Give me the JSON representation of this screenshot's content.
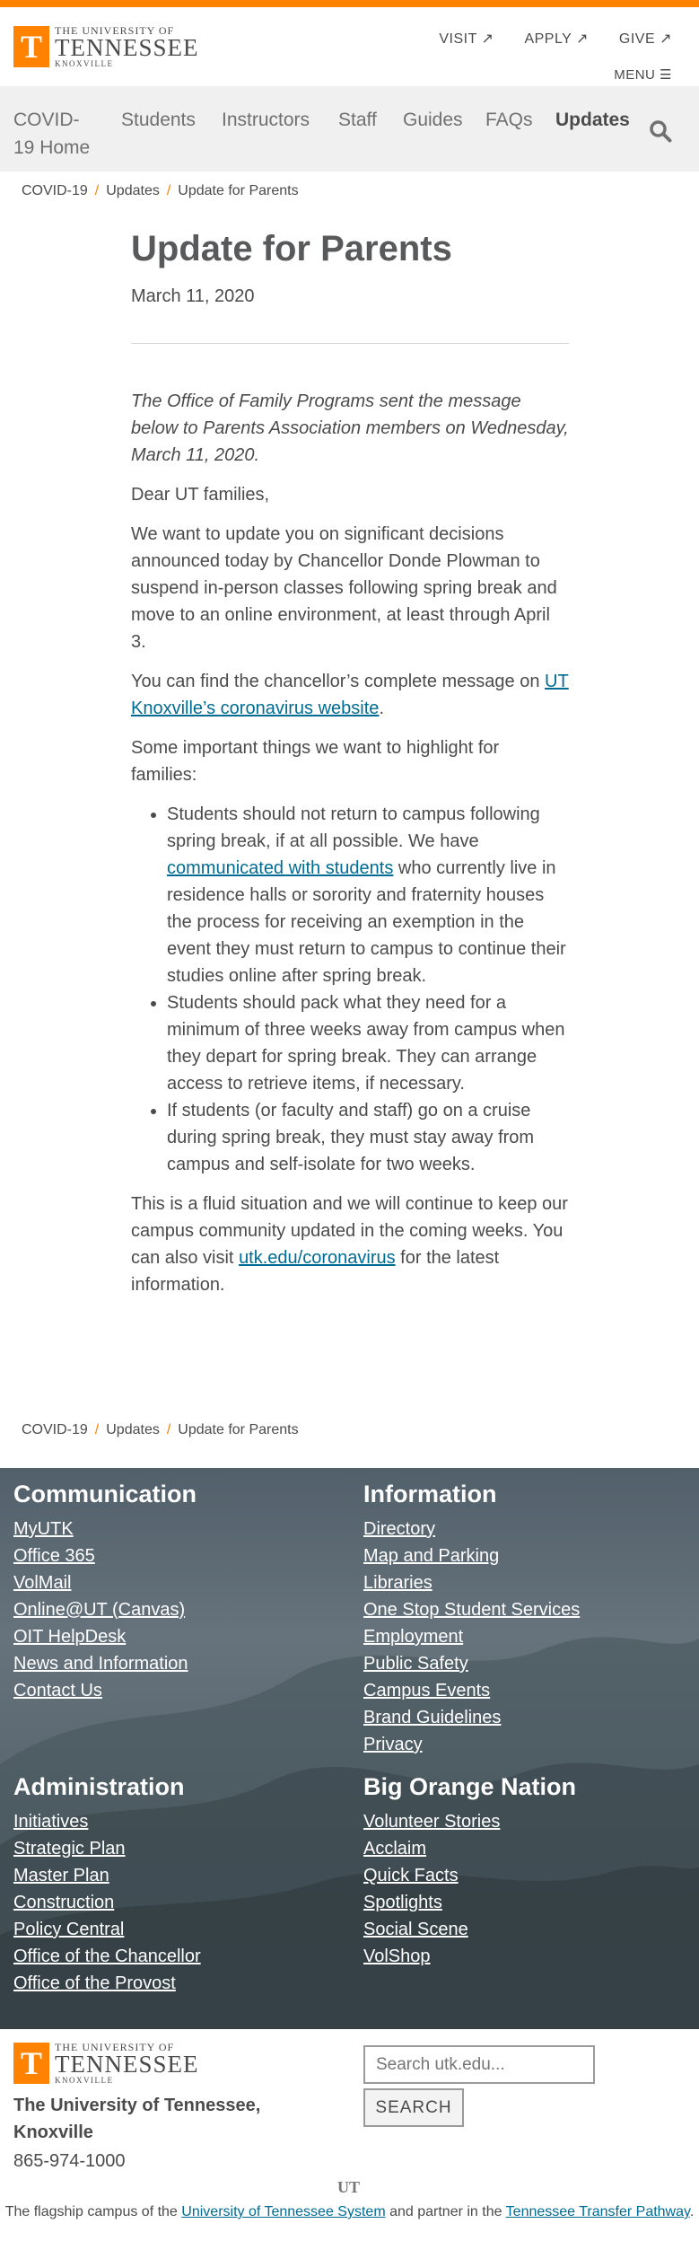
{
  "header": {
    "logo": {
      "line1": "THE UNIVERSITY OF",
      "line2": "TENNESSEE",
      "line3": "KNOXVILLE",
      "mark": "T"
    },
    "util_nav": [
      {
        "label": "VISIT ↗"
      },
      {
        "label": "APPLY ↗"
      },
      {
        "label": "GIVE ↗"
      }
    ],
    "menu_label": "MENU ☰"
  },
  "nav": {
    "items": [
      {
        "label": "COVID-\n19 Home"
      },
      {
        "label": "Students"
      },
      {
        "label": "Instructors"
      },
      {
        "label": "Staff"
      },
      {
        "label": "Guides"
      },
      {
        "label": "FAQs"
      },
      {
        "label": "Updates"
      }
    ]
  },
  "breadcrumb": [
    "COVID-19",
    "Updates",
    "Update for Parents"
  ],
  "article": {
    "title": "Update for Parents",
    "date": "March 11, 2020",
    "intro": "The Office of Family Programs sent the message below to Parents Association members on Wednesday, March 11, 2020.",
    "greeting": "Dear UT families,",
    "p1": "We want to update you on significant decisions announced today by Chancellor Donde Plowman to suspend in-person classes following spring break and move to an online environment, at least through April 3.",
    "p2_before": "You can find the chancellor’s complete message on ",
    "p2_link": "UT Knoxville’s coronavirus website",
    "p2_after": ".",
    "p3": "Some important things we want to highlight for families:",
    "bullet1_before": "Students should not return to campus following spring break, if at all possible. We have ",
    "bullet1_link": "communicated with students",
    "bullet1_after": " who currently live in residence halls or sorority and fraternity houses the process for receiving an exemption in the event they must return to campus to continue their studies online after spring break.",
    "bullet2": "Students should pack what they need for a minimum of three weeks away from campus when they depart for spring break. They can arrange access to retrieve items, if necessary.",
    "bullet3": "If students (or faculty and staff) go on a cruise during spring break, they must stay away from campus and self-isolate for two weeks.",
    "p4_before": "This is a fluid situation and we will continue to keep our campus community updated in the coming weeks. You can also visit ",
    "p4_link": "utk.edu/coronavirus",
    "p4_after": " for the latest information."
  },
  "footer": {
    "communication": {
      "heading": "Communication",
      "links": [
        "MyUTK",
        "Office 365",
        "VolMail",
        "Online@UT (Canvas)",
        "OIT HelpDesk",
        "News and Information",
        "Contact Us"
      ]
    },
    "information": {
      "heading": "Information",
      "links": [
        "Directory",
        "Map and Parking",
        "Libraries",
        "One Stop Student Services",
        "Employment",
        "Public Safety",
        "Campus Events",
        "Brand Guidelines",
        "Privacy"
      ]
    },
    "administration": {
      "heading": "Administration",
      "links": [
        "Initiatives",
        "Strategic Plan",
        "Master Plan",
        "Construction",
        "Policy Central",
        "Office of the Chancellor",
        "Office of the Provost"
      ]
    },
    "big_orange": {
      "heading": "Big Orange Nation",
      "links": [
        "Volunteer Stories",
        "Acclaim",
        "Quick Facts",
        "Spotlights",
        "Social Scene",
        "VolShop"
      ]
    }
  },
  "bottom": {
    "name": "The University of Tennessee, Knoxville",
    "phone": "865-974-1000",
    "search_placeholder": "Search utk.edu...",
    "search_button": "SEARCH",
    "system_mark": "UT",
    "flag_before": "The flagship campus of the ",
    "flag_link1": "University of Tennessee System",
    "flag_middle": " and partner in the ",
    "flag_link2": "Tennessee Transfer Pathway",
    "flag_after": "."
  },
  "colors": {
    "accent": "#ff8200",
    "link": "#006c93",
    "text": "#4b4b4b",
    "nav_bg": "#f0f0f0"
  }
}
